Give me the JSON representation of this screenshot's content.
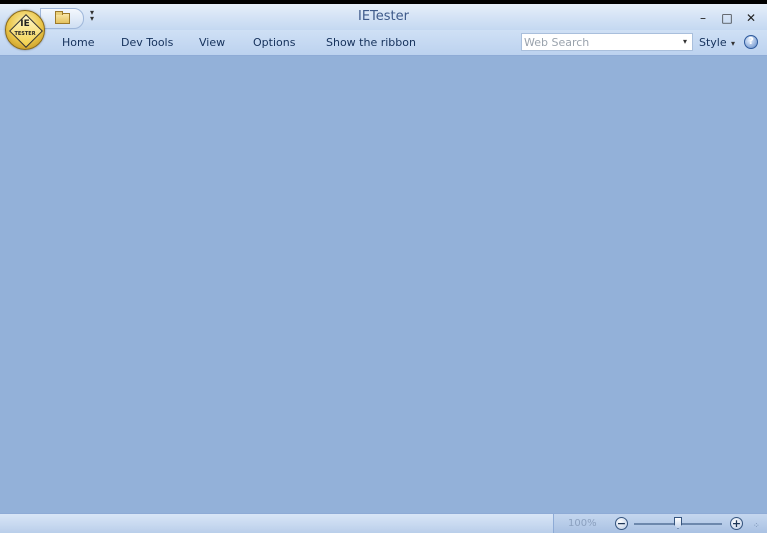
{
  "window": {
    "title": "IETester"
  },
  "app_icon": {
    "label": "IE",
    "sublabel": "TESTER"
  },
  "window_controls": {
    "minimize": "–",
    "maximize": "□",
    "close": "✕"
  },
  "menu": {
    "items": [
      {
        "label": "Home"
      },
      {
        "label": "Dev Tools"
      },
      {
        "label": "View"
      },
      {
        "label": "Options"
      },
      {
        "label": "Show the ribbon"
      }
    ]
  },
  "search": {
    "placeholder": "Web Search",
    "value": ""
  },
  "style_menu": {
    "label": "Style"
  },
  "help": {
    "label": "?"
  },
  "statusbar": {
    "zoom_level": "100%",
    "zoom_out_label": "−",
    "zoom_in_label": "+",
    "zoom_fraction": 0.5
  }
}
